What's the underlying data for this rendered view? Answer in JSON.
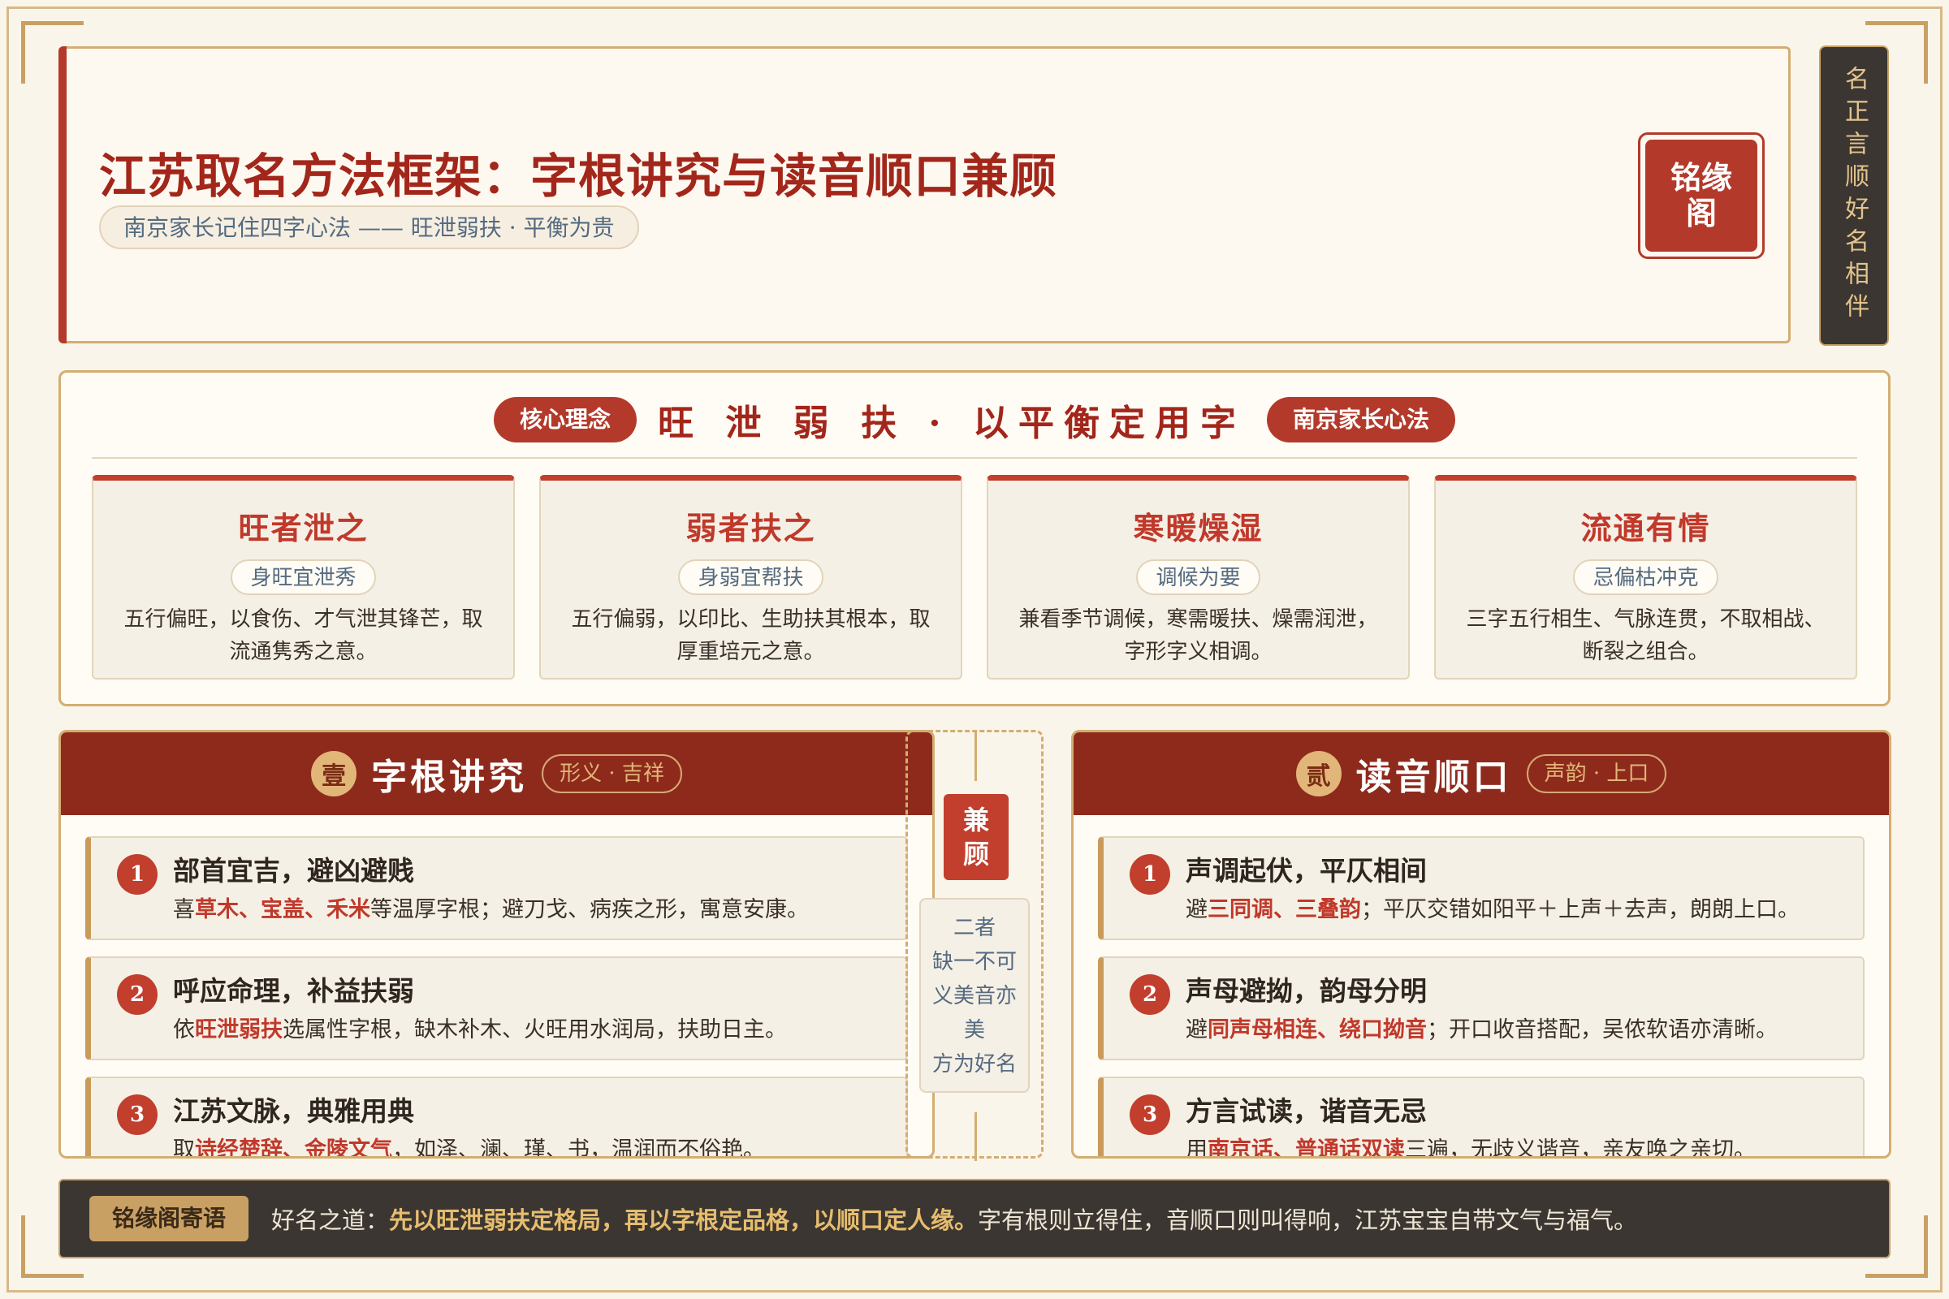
{
  "header": {
    "title": "江苏取名方法框架：字根讲究与读音顺口兼顾",
    "subtitle": "南京家长记住四字心法 —— 旺泄弱扶 · 平衡为贵",
    "seal": "铭缘阁"
  },
  "side_banner": "名正言顺好名相伴",
  "core": {
    "left_pill": "核心理念",
    "title": "旺 泄 弱 扶 · 以平衡定用字",
    "right_pill": "南京家长心法",
    "cards": [
      {
        "title": "旺者泄之",
        "tag": "身旺宜泄秀",
        "desc": "五行偏旺，以食伤、才气泄其锋芒，取流通隽秀之意。"
      },
      {
        "title": "弱者扶之",
        "tag": "身弱宜帮扶",
        "desc": "五行偏弱，以印比、生助扶其根本，取厚重培元之意。"
      },
      {
        "title": "寒暖燥湿",
        "tag": "调候为要",
        "desc": "兼看季节调候，寒需暖扶、燥需润泄，字形字义相调。"
      },
      {
        "title": "流通有情",
        "tag": "忌偏枯冲克",
        "desc": "三字五行相生、气脉连贯，不取相战、断裂之组合。"
      }
    ]
  },
  "left_column": {
    "badge": "壹",
    "title": "字根讲究",
    "tag": "形义 · 吉祥",
    "items": [
      {
        "num": "1",
        "title": "部首宜吉，避凶避贱",
        "pre": "喜",
        "hl": "草木、宝盖、禾米",
        "post": "等温厚字根；避刀戈、病疾之形，寓意安康。"
      },
      {
        "num": "2",
        "title": "呼应命理，补益扶弱",
        "pre": "依",
        "hl": "旺泄弱扶",
        "post": "选属性字根，缺木补木、火旺用水润局，扶助日主。"
      },
      {
        "num": "3",
        "title": "江苏文脉，典雅用典",
        "pre": "取",
        "hl": "诗经楚辞、金陵文气",
        "post": "，如泽、澜、瑾、书，温润而不俗艳。"
      }
    ]
  },
  "middle": {
    "badge": "兼顾",
    "note": [
      "二者",
      "缺一不可",
      "义美音亦",
      "美",
      "方为好名"
    ]
  },
  "right_column": {
    "badge": "贰",
    "title": "读音顺口",
    "tag": "声韵 · 上口",
    "items": [
      {
        "num": "1",
        "title": "声调起伏，平仄相间",
        "pre": "避",
        "hl": "三同调、三叠韵",
        "post": "；平仄交错如阳平＋上声＋去声，朗朗上口。"
      },
      {
        "num": "2",
        "title": "声母避拗，韵母分明",
        "pre": "避",
        "hl": "同声母相连、绕口拗音",
        "post": "；开口收音搭配，吴侬软语亦清晰。"
      },
      {
        "num": "3",
        "title": "方言试读，谐音无忌",
        "pre": "用",
        "hl": "南京话、普通话双读",
        "post": "三遍，无歧义谐音，亲友唤之亲切。"
      }
    ]
  },
  "footer": {
    "badge": "铭缘阁寄语",
    "lead": "好名之道：",
    "gold": "先以旺泄弱扶定格局，再以字根定品格，以顺口定人缘。",
    "tail": "字有根则立得住，音顺口则叫得响，江苏宝宝自带文气与福气。"
  }
}
